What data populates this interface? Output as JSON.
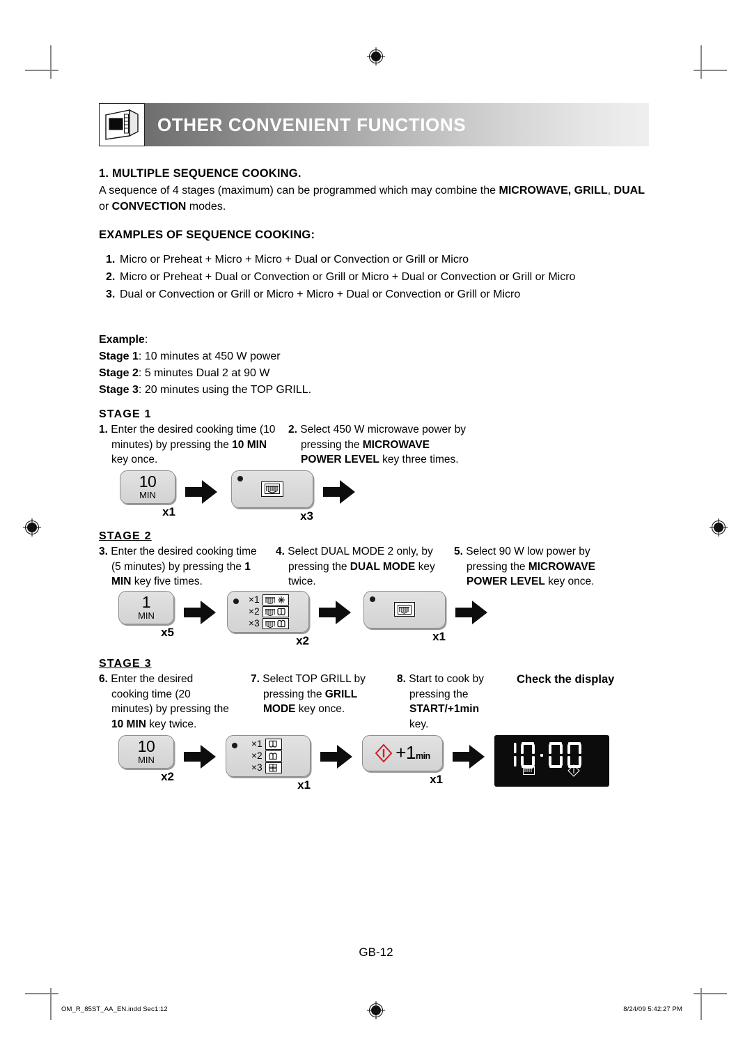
{
  "header": {
    "title": "OTHER CONVENIENT FUNCTIONS",
    "icon": "microwave-oven-icon"
  },
  "section1": {
    "heading": "1. MULTIPLE SEQUENCE COOKING.",
    "para_a": "A sequence of 4 stages (maximum) can be programmed which may combine the ",
    "para_bold1": "MICROWAVE, GRILL",
    "para_b": ", ",
    "para_bold2": "DUAL",
    "para_c": " or ",
    "para_bold3": "CONVECTION",
    "para_d": " modes."
  },
  "examples": {
    "heading": "EXAMPLES OF SEQUENCE COOKING:",
    "items": [
      {
        "num": "1.",
        "text": "Micro or Preheat + Micro + Micro + Dual or Convection or Grill or Micro"
      },
      {
        "num": "2.",
        "text": "Micro or Preheat + Dual or Convection or Grill or Micro + Dual or Convection or Grill or Micro"
      },
      {
        "num": "3.",
        "text": "Dual or Convection or Grill or Micro + Micro + Dual or Convection or Grill or Micro"
      }
    ]
  },
  "example": {
    "label": "Example",
    "colon": ":",
    "lines": [
      {
        "bold": "Stage 1",
        "rest": ": 10 minutes at 450 W power"
      },
      {
        "bold": "Stage 2",
        "rest": ": 5 minutes Dual 2 at 90 W"
      },
      {
        "bold": "Stage 3",
        "rest": ": 20 minutes using the TOP GRILL."
      }
    ]
  },
  "stage1": {
    "label": "STAGE 1",
    "step1": {
      "num": "1.",
      "t1": "Enter the desired cooking time (10 minutes) by pressing the ",
      "b1": "10 MIN",
      "t2": " key once."
    },
    "step2": {
      "num": "2.",
      "t1": "Select 450 W microwave power by pressing the ",
      "b1": "MICROWAVE POWER LEVEL",
      "t2": " key three times."
    },
    "key1": {
      "name": "10-min-key",
      "big": "10",
      "sub": "MIN",
      "count": "x1"
    },
    "key2": {
      "name": "microwave-power-level-key",
      "icon": "microwave-power-icon",
      "count": "x3"
    }
  },
  "stage2": {
    "label": "STAGE 2",
    "step3": {
      "num": "3.",
      "t1": "Enter the desired cooking time (5 minutes) by pressing the ",
      "b1": "1 MIN",
      "t2": " key five times."
    },
    "step4": {
      "num": "4.",
      "t1": "Select DUAL MODE 2 only, by pressing the ",
      "b1": "DUAL MODE",
      "t2": " key twice."
    },
    "step5": {
      "num": "5.",
      "t1": "Select 90 W low power by pressing the ",
      "b1": "MICROWAVE POWER LEVEL",
      "t2": " key once."
    },
    "key3": {
      "name": "1-min-key",
      "big": "1",
      "sub": "MIN",
      "count": "x5"
    },
    "key4": {
      "name": "dual-mode-key",
      "count": "x2",
      "options": [
        {
          "label": "×1",
          "icon": "micro-convection-icon"
        },
        {
          "label": "×2",
          "icon": "micro-top-grill-icon"
        },
        {
          "label": "×3",
          "icon": "micro-bottom-grill-icon"
        }
      ]
    },
    "key5": {
      "name": "microwave-power-level-key",
      "icon": "microwave-power-icon",
      "count": "x1"
    }
  },
  "stage3": {
    "label": "STAGE 3",
    "step6": {
      "num": "6.",
      "t1": "Enter the desired cooking time (20 minutes) by pressing the ",
      "b1": "10 MIN",
      "t2": " key twice."
    },
    "step7": {
      "num": "7.",
      "t1": "Select TOP GRILL by pressing the ",
      "b1": "GRILL MODE",
      "t2": " key once."
    },
    "step8": {
      "num": "8.",
      "t1": "Start to cook by pressing the ",
      "b1": "START/+1min",
      "t2": " key."
    },
    "check_display": "Check the display",
    "key6": {
      "name": "10-min-key",
      "big": "10",
      "sub": "MIN",
      "count": "x2"
    },
    "key7": {
      "name": "grill-mode-key",
      "count": "x1",
      "options": [
        {
          "label": "×1",
          "icon": "top-grill-icon"
        },
        {
          "label": "×2",
          "icon": "bottom-grill-icon"
        },
        {
          "label": "×3",
          "icon": "double-grill-icon"
        }
      ]
    },
    "key8": {
      "name": "start-plus-1min-key",
      "plus": "+1",
      "unit": "min",
      "count": "x1"
    },
    "display": {
      "name": "oven-display",
      "time": "10:00",
      "icons": [
        "microwave-indicator-icon",
        "start-diamond-icon"
      ]
    }
  },
  "footer": {
    "page": "GB-12",
    "file": "OM_R_85ST_AA_EN.indd   Sec1:12",
    "timestamp": "8/24/09   5:42:27 PM"
  },
  "colors": {
    "accent_red": "#cc2026",
    "key_face": "#dcdcdc",
    "key_border": "#8e8e8e",
    "display_bg": "#0c0c0c"
  }
}
